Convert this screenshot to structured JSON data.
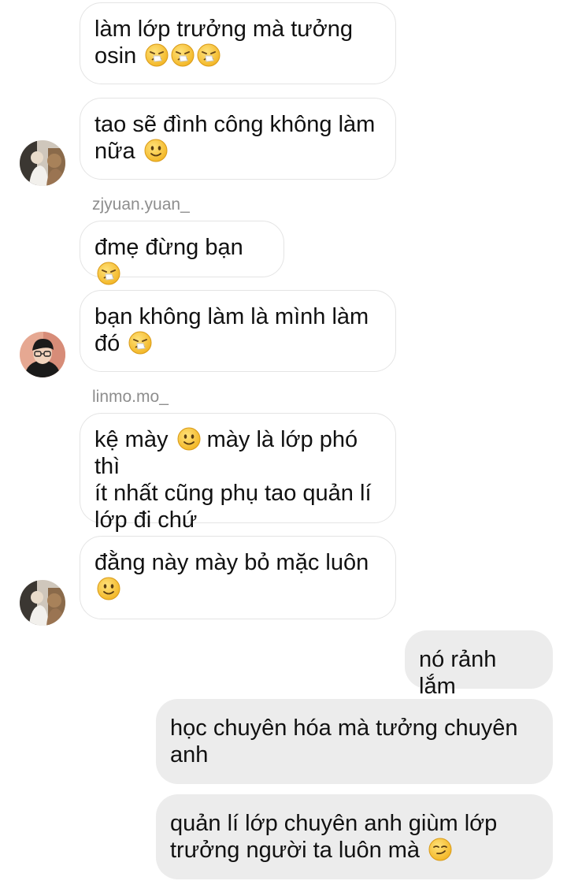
{
  "conversation": {
    "messages": [
      {
        "text": "làm lớp trưởng mà tưởng osin",
        "emoji": [
          "sneezing-face",
          "sneezing-face",
          "sneezing-face"
        ]
      },
      {
        "text": "tao sẽ đình công không làm nữa",
        "emoji": [
          "slightly-smiling-face"
        ]
      },
      {
        "sender": "zjyuan.yuan_",
        "text": "đmẹ đừng bạn",
        "emoji": [
          "sneezing-face"
        ]
      },
      {
        "text": "bạn không làm là mình làm đó",
        "emoji": [
          "sneezing-face"
        ]
      },
      {
        "sender": "linmo.mo_",
        "text_a": "kệ mày",
        "text_b": "mày là lớp phó thì",
        "text_c": "ít nhất cũng phụ tao quản lí",
        "text_d": "lớp đi chứ",
        "emoji": [
          "slightly-smiling-face"
        ]
      },
      {
        "text": "đằng này mày bỏ mặc luôn",
        "emoji": [
          "slightly-smiling-face"
        ]
      },
      {
        "text": "nó rảnh lắm"
      },
      {
        "text": "học chuyên hóa mà tưởng chuyên anh"
      },
      {
        "text": "quản lí lớp chuyên anh giùm lớp trưởng người ta luôn mà",
        "emoji": [
          "smirking-face"
        ]
      }
    ],
    "avatars": {
      "zjyuan": "avatar-zjyuan-yuan",
      "linmo": "avatar-linmo-mo"
    },
    "colors": {
      "incoming_bubble_border": "#e4e4e4",
      "outgoing_bubble_bg": "#ececec",
      "sender_name": "#8e8e8e",
      "emoji_yellow": "#f7c531"
    }
  }
}
